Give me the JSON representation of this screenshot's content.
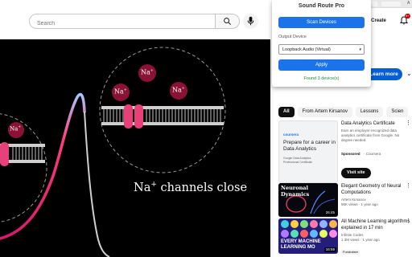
{
  "search": {
    "placeholder": "Search"
  },
  "header": {
    "create_label": "Create",
    "notification_count": "9+",
    "tab_label": "A"
  },
  "video": {
    "caption_main": "Na",
    "caption_sup": "+",
    "caption_rest": " channels close",
    "ion_label": "Na",
    "ion_sup": "+"
  },
  "ad_promo": {
    "learn_more_label": "Learn more"
  },
  "chips": [
    "All",
    "From Artem Kirsanov",
    "Lessons",
    "Scien"
  ],
  "ad_card": {
    "brand": "coursera",
    "headline": "Prepare for a career in Data Analytics",
    "foot_line1": "Google Data Analytics",
    "foot_line2": "Professional Certificate",
    "title": "Data Analytics Certificate",
    "description": "Earn an employer-recognized data analytics certificate from Google. No degree needed.",
    "sponsored": "Sponsored",
    "advertiser": "· Coursera",
    "visit_label": "Visit site"
  },
  "videos": [
    {
      "thumb_text": "Neuronal Dynamics",
      "duration": "26:45",
      "title": "Elegant Geometry of Neural Computations",
      "channel": "Artem Kirsanov",
      "stats": "56K views · 1 year ago"
    },
    {
      "thumb_text": "EVERY MACHINE LEARNING MO",
      "duration": "16:59",
      "title": "All Machine Learning algorithms explained in 17 min",
      "channel": "Infinite Codes",
      "stats": "1.3M views · 1 year ago",
      "badge": "Fundraiser"
    }
  ],
  "popup": {
    "title": "Sound Route Pro",
    "scan_label": "Scan Devices",
    "output_label": "Output Device",
    "selected_device": "Loopback Audio (Virtual)",
    "apply_label": "Apply",
    "status": "Found 3 device(s)"
  },
  "colors": {
    "accent_blue": "#1a73e8",
    "status_green": "#1e8e3e",
    "channel_pink": "#e8407a",
    "ion_red": "#8a1235"
  }
}
